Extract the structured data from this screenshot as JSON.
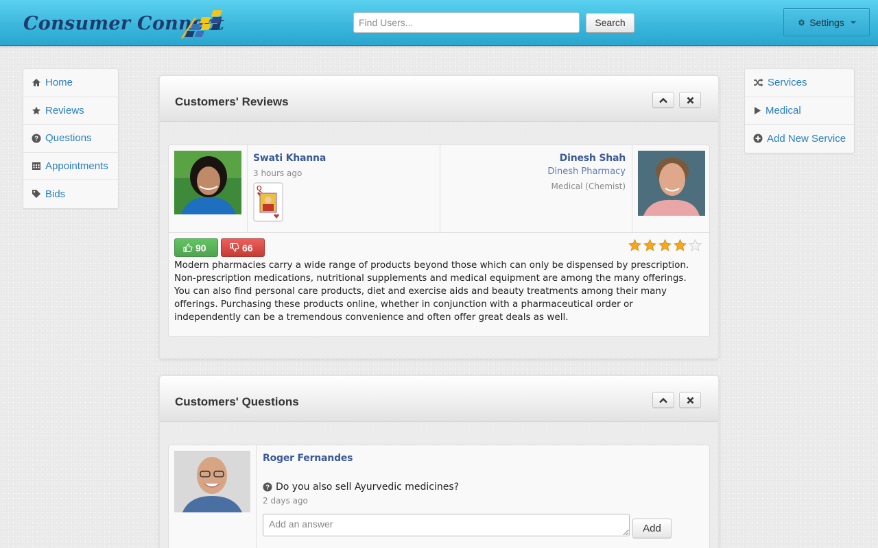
{
  "brand": {
    "name": "Consumer Connect"
  },
  "search": {
    "placeholder": "Find Users...",
    "button_label": "Search"
  },
  "settings": {
    "label": "Settings"
  },
  "left_nav": [
    {
      "label": "Home",
      "icon": "home-icon"
    },
    {
      "label": "Reviews",
      "icon": "star-icon"
    },
    {
      "label": "Questions",
      "icon": "question-icon"
    },
    {
      "label": "Appointments",
      "icon": "calendar-icon"
    },
    {
      "label": "Bids",
      "icon": "tag-icon"
    }
  ],
  "right_nav": [
    {
      "label": "Services",
      "icon": "shuffle-icon"
    },
    {
      "label": "Medical",
      "icon": "play-icon"
    },
    {
      "label": "Add New Service",
      "icon": "plus-circle-icon"
    }
  ],
  "reviews": {
    "title": "Customers' Reviews",
    "reviewer": {
      "name": "Swati Khanna",
      "time": "3 hours ago"
    },
    "business": {
      "name": "Dinesh Shah",
      "company": "Dinesh Pharmacy",
      "category": "Medical (Chemist)"
    },
    "upvotes": "90",
    "downvotes": "66",
    "rating": 4,
    "rating_max": 5,
    "text": "Modern pharmacies carry a wide range of products beyond those which can only be dispensed by prescription. Non-prescription medications, nutritional supplements and medical equipment are among the many offerings. You can also find personal care products, diet and exercise aids and beauty treatments among their many offerings. Purchasing these products online, whether in conjunction with a pharmaceutical order or independently can be a tremendous convenience and often offer great deals as well."
  },
  "questions": {
    "title": "Customers' Questions",
    "asker": {
      "name": "Roger Fernandes"
    },
    "question": "Do you also sell Ayurvedic medicines?",
    "time": "2 days ago",
    "answer_placeholder": "Add an answer",
    "add_label": "Add"
  },
  "colors": {
    "navbar": "#3cb7dc",
    "link": "#2a7fc0",
    "name": "#3b5998",
    "upvote": "#51a351",
    "downvote": "#c43c35",
    "star": "#f5a623"
  }
}
